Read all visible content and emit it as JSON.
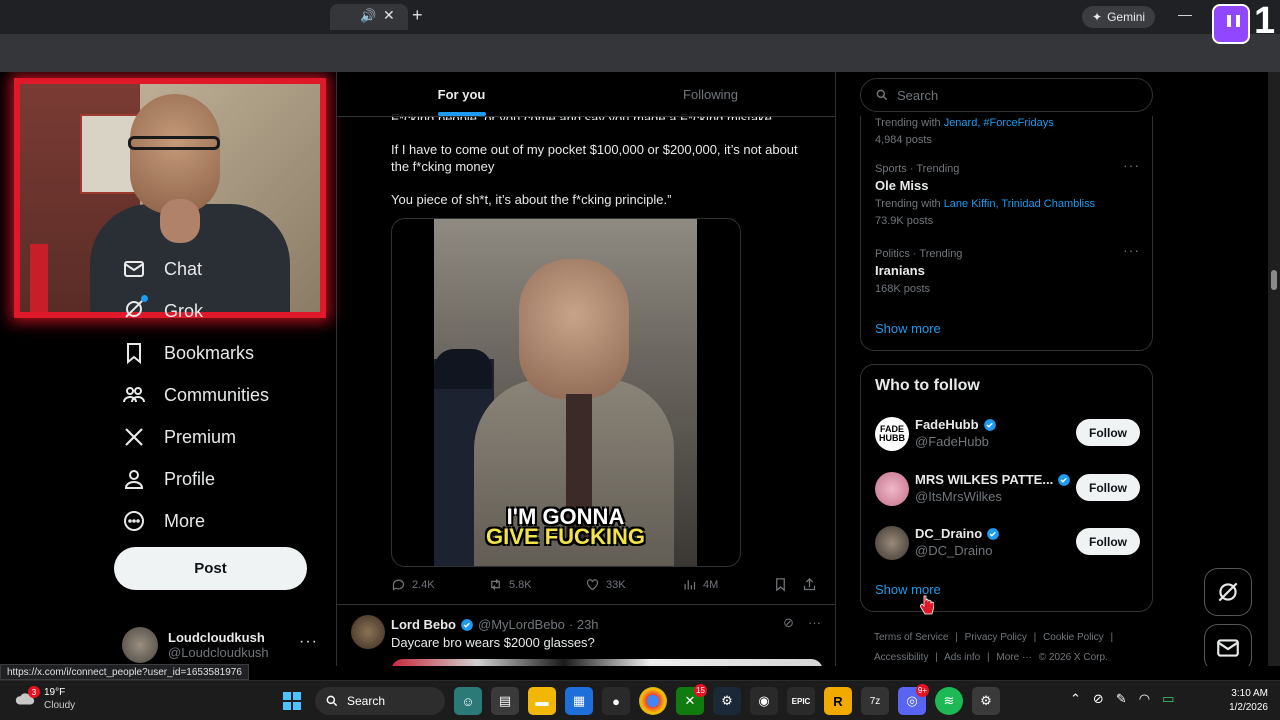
{
  "browser": {
    "tab_audio_icon": "speaker-icon",
    "gemini_label": "Gemini",
    "status_url": "https://x.com/i/connect_people?user_id=1653581976"
  },
  "overlay": {
    "twitch_count": "1"
  },
  "nav": {
    "items": [
      {
        "label": "Chat",
        "icon": "mail-icon"
      },
      {
        "label": "Grok",
        "icon": "grok-icon"
      },
      {
        "label": "Bookmarks",
        "icon": "bookmark-icon"
      },
      {
        "label": "Communities",
        "icon": "communities-icon"
      },
      {
        "label": "Premium",
        "icon": "x-logo-icon"
      },
      {
        "label": "Profile",
        "icon": "person-icon"
      },
      {
        "label": "More",
        "icon": "more-circle-icon"
      }
    ],
    "post_label": "Post",
    "account_name": "Loudcloudkush",
    "account_handle": "@Loudcloudkush"
  },
  "feed": {
    "tabs": [
      "For you",
      "Following"
    ],
    "tweet1": {
      "line0": "F*cking people, or you come and say you made a F*cking mistake",
      "line1": "If I have to come out of my pocket $100,000 or $200,000, it’s not about the f*cking money",
      "line2": "You piece of sh*t, it’s about the f*cking principle.”",
      "caption_top": "I'M GONNA",
      "caption_bottom": "GIVE FUCKING",
      "replies": "2.4K",
      "reposts": "5.8K",
      "likes": "33K",
      "views": "4M"
    },
    "tweet2": {
      "name": "Lord Bebo",
      "handle": "@MyLordBebo",
      "time": "· 23h",
      "text": "Daycare bro wears $2000 glasses?"
    }
  },
  "sidebar": {
    "search_placeholder": "Search",
    "trends": [
      {
        "meta": "",
        "title": "",
        "with_prefix": "Trending with",
        "with_links": "Jenard, #ForceFridays",
        "posts": "4,984 posts"
      },
      {
        "meta": "Sports · Trending",
        "title": "Ole Miss",
        "with_prefix": "Trending with",
        "with_links": "Lane Kiffin, Trinidad Chambliss",
        "posts": "73.9K posts"
      },
      {
        "meta": "Politics · Trending",
        "title": "Iranians",
        "with_prefix": "",
        "with_links": "",
        "posts": "168K posts"
      }
    ],
    "show_more": "Show more",
    "who_to_follow_title": "Who to follow",
    "follow_suggestions": [
      {
        "name": "FadeHubb",
        "handle": "@FadeHubb",
        "button": "Follow"
      },
      {
        "name": "MRS WILKES PATTE...",
        "handle": "@ItsMrsWilkes",
        "button": "Follow"
      },
      {
        "name": "DC_Draino",
        "handle": "@DC_Draino",
        "button": "Follow"
      }
    ],
    "show_more_2": "Show more",
    "footer": [
      "Terms of Service",
      "|",
      "Privacy Policy",
      "|",
      "Cookie Policy",
      "|",
      "Accessibility",
      "|",
      "Ads info",
      "|",
      "More ···",
      "© 2026 X Corp."
    ]
  },
  "taskbar": {
    "weather_badge": "3",
    "temp": "19°F",
    "condition": "Cloudy",
    "search_label": "Search",
    "xbox_badge": "15",
    "discord_badge": "9+",
    "time": "3:10 AM",
    "date": "1/2/2026"
  },
  "colors": {
    "accent": "#1d9bf0",
    "webcam_border": "#e0192a",
    "twitch": "#9146ff"
  }
}
